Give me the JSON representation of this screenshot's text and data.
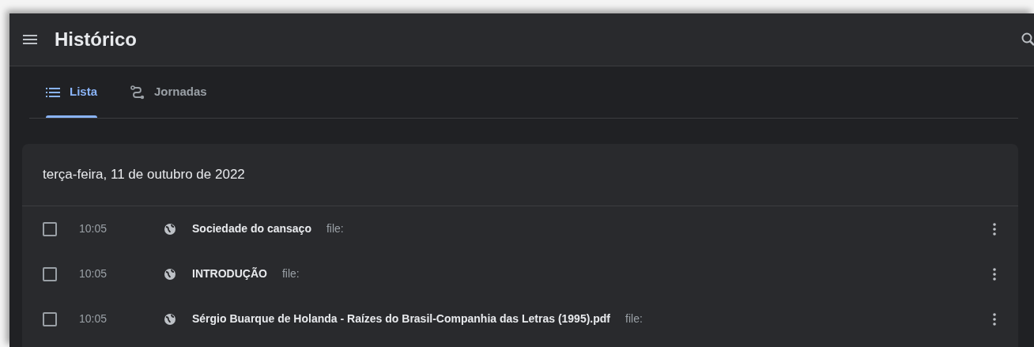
{
  "window": {
    "title": "Histórico"
  },
  "tabs": [
    {
      "label": "Lista",
      "selected": true,
      "kind": "list"
    },
    {
      "label": "Jornadas",
      "selected": false,
      "kind": "journeys"
    }
  ],
  "card": {
    "date": "terça-feira, 11 de outubro de 2022",
    "rows": [
      {
        "checked": false,
        "time": "10:05",
        "title": "Sociedade do cansaço",
        "domain": "file:"
      },
      {
        "checked": false,
        "time": "10:05",
        "title": "INTRODUÇÃO",
        "domain": "file:"
      },
      {
        "checked": false,
        "time": "10:05",
        "title": "Sérgio Buarque de Holanda - Raízes do Brasil-Companhia das Letras (1995).pdf",
        "domain": "file:"
      }
    ]
  }
}
